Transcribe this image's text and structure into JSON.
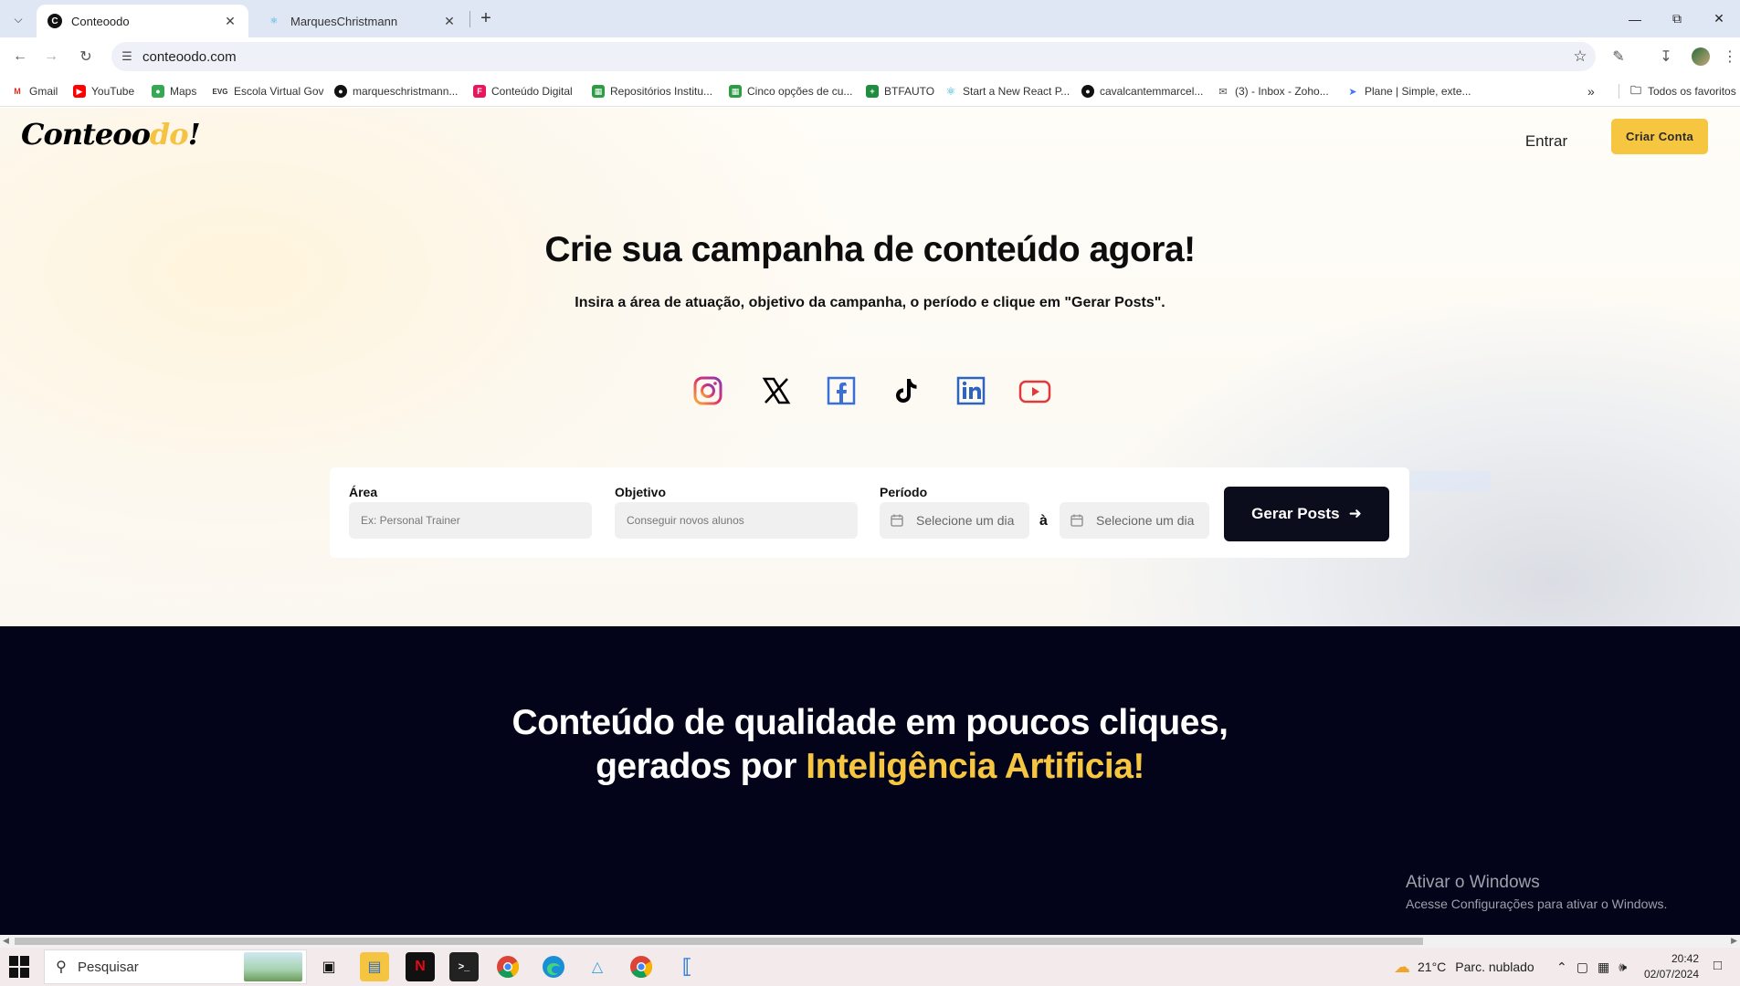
{
  "browser": {
    "tabs": [
      {
        "title": "Conteoodo",
        "active": true
      },
      {
        "title": "MarquesChristmann",
        "active": false
      }
    ],
    "url": "conteoodo.com",
    "bookmarks": [
      {
        "label": "Gmail",
        "icon": "gmail-icon",
        "color": "#d93025"
      },
      {
        "label": "YouTube",
        "icon": "youtube-icon",
        "color": "#ff0000"
      },
      {
        "label": "Maps",
        "icon": "maps-icon",
        "color": "#34a853"
      },
      {
        "label": "Escola Virtual Gov",
        "icon": "evg-icon",
        "color": "#333333"
      },
      {
        "label": "marqueschristmann...",
        "icon": "github-icon",
        "color": "#111111"
      },
      {
        "label": "Conteúdo Digital",
        "icon": "conteudo-digital-icon",
        "color": "#e8175d"
      },
      {
        "label": "Repositórios Institu...",
        "icon": "grid-icon",
        "color": "#2e9b45"
      },
      {
        "label": "Cinco opções de cu...",
        "icon": "grid-icon",
        "color": "#2e9b45"
      },
      {
        "label": "BTFAUTO",
        "icon": "plus-box-icon",
        "color": "#1e8e3e"
      },
      {
        "label": "Start a New React P...",
        "icon": "react-icon",
        "color": "#23a9d8"
      },
      {
        "label": "cavalcantemmarcel...",
        "icon": "github-icon",
        "color": "#111111"
      },
      {
        "label": "(3) - Inbox - Zoho...",
        "icon": "mail-icon",
        "color": "#555555"
      },
      {
        "label": "Plane | Simple, exte...",
        "icon": "plane-icon",
        "color": "#3f76ff"
      }
    ],
    "bookmarks_folder": "Todos os favoritos"
  },
  "header": {
    "logo_main": "Conteoo",
    "logo_accent": "do",
    "logo_end": "!",
    "login_label": "Entrar",
    "signup_label": "Criar Conta"
  },
  "hero": {
    "title": "Crie sua campanha de conteúdo agora!",
    "subtitle": "Insira a área de atuação, objetivo da campanha, o período e clique em \"Gerar Posts\".",
    "socials": [
      "instagram-icon",
      "x-icon",
      "facebook-icon",
      "tiktok-icon",
      "linkedin-icon",
      "youtube-icon"
    ]
  },
  "form": {
    "area_label": "Área",
    "area_placeholder": "Ex: Personal Trainer",
    "objective_label": "Objetivo",
    "objective_placeholder": "Conseguir novos alunos",
    "period_label": "Período",
    "start_placeholder": "Selecione um dia",
    "range_separator": "à",
    "end_placeholder": "Selecione um dia",
    "submit_label": "Gerar Posts"
  },
  "section2": {
    "line1": "Conteúdo de qualidade em poucos cliques,",
    "line2_prefix": "gerados por ",
    "line2_highlight": "Inteligência Artificia!"
  },
  "windows_watermark": {
    "title": "Ativar o Windows",
    "subtitle": "Acesse Configurações para ativar o Windows."
  },
  "taskbar": {
    "search_placeholder": "Pesquisar",
    "weather": "21°C",
    "weather_desc": "Parc. nublado",
    "time": "20:42",
    "date": "02/07/2024"
  },
  "colors": {
    "accent": "#f6c641",
    "dark_bg": "#03031a",
    "button_dark": "#0b0c1c"
  }
}
